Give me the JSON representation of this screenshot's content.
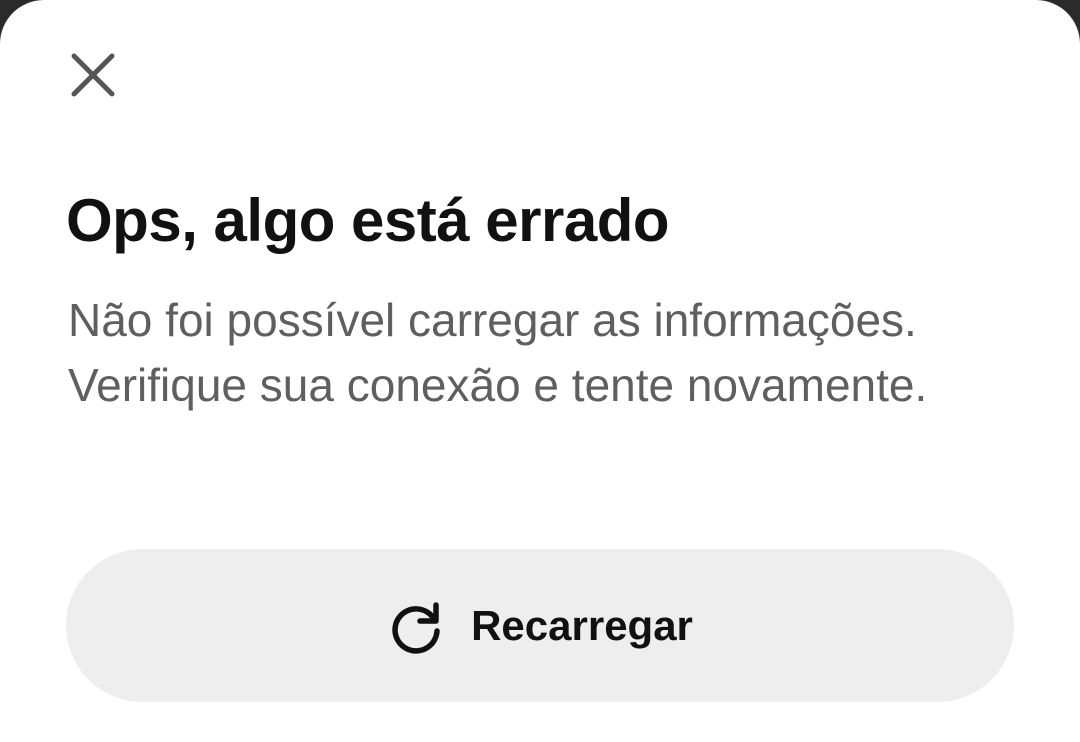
{
  "dialog": {
    "close_icon": "close-icon",
    "title": "Ops, algo está errado",
    "message": "Não foi possível carregar as informações. Verifique sua conexão e tente novamente.",
    "reload_button": {
      "icon": "refresh-icon",
      "label": "Recarregar"
    }
  },
  "colors": {
    "background": "#ffffff",
    "title": "#111111",
    "message": "#5f5f5f",
    "button_background": "#eeeeee",
    "icon": "#555555"
  }
}
